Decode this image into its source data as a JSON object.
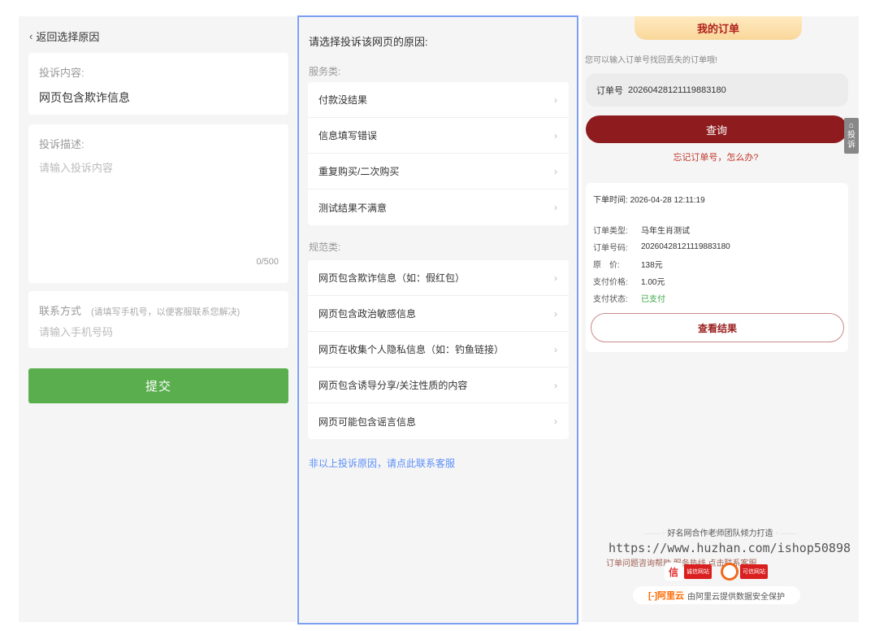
{
  "left": {
    "back_label": "返回选择原因",
    "complaint_content_label": "投诉内容:",
    "complaint_content_value": "网页包含欺诈信息",
    "description_label": "投诉描述:",
    "description_placeholder": "请输入投诉内容",
    "char_count": "0/500",
    "contact_label": "联系方式",
    "contact_hint": "(请填写手机号，以便客服联系您解决)",
    "phone_placeholder": "请输入手机号码",
    "submit_label": "提交"
  },
  "middle": {
    "title": "请选择投诉该网页的原因:",
    "service_section": "服务类:",
    "service_items": [
      "付款没结果",
      "信息填写错误",
      "重复购买/二次购买",
      "测试结果不满意"
    ],
    "norm_section": "规范类:",
    "norm_items": [
      "网页包含欺诈信息（如：假红包）",
      "网页包含政治敏感信息",
      "网页在收集个人隐私信息（如：钓鱼链接）",
      "网页包含诱导分享/关注性质的内容",
      "网页可能包含谣言信息"
    ],
    "contact_link": "非以上投诉原因，请点此联系客服"
  },
  "right": {
    "tab_title": "我的订单",
    "hint": "您可以输入订单号找回丢失的订单哦!",
    "order_label": "订单号",
    "order_number": "20260428121119883180",
    "query_label": "查询",
    "forgot_link": "忘记订单号，怎么办?",
    "side_tab": [
      "投",
      "诉"
    ],
    "order_time_label": "下单时间:",
    "order_time": "2026-04-28 12:11:19",
    "details": [
      {
        "key": "订单类型:",
        "value": "马年生肖测试"
      },
      {
        "key": "订单号码:",
        "value": "20260428121119883180"
      },
      {
        "key": "原　价:",
        "value": "138元"
      },
      {
        "key": "支付价格:",
        "value": "1.00元"
      },
      {
        "key": "支付状态:",
        "value": "已支付"
      }
    ],
    "view_result_label": "查看结果",
    "footer_team": "好名网合作老师团队倾力打造",
    "watermark": "https://www.huzhan.com/ishop50898",
    "footer_help": "订单问题咨询帮助    服务热线 点击联系客服",
    "badge1": "诚信网站",
    "badge2": "可信网站",
    "aliyun_logo": "[-]阿里云",
    "aliyun_text": "由阿里云提供数据安全保护"
  },
  "colors": {
    "submit_green": "#5aae4e",
    "query_red": "#8e1c1f",
    "link_blue": "#5b8ff9",
    "paid_green": "#3aa544"
  }
}
